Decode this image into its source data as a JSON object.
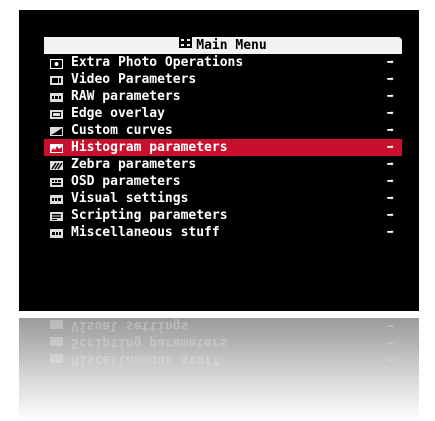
{
  "menu": {
    "title": "Main Menu",
    "title_icon": "menu-grid-icon",
    "selected_index": 5,
    "selected_color": "#c8102e",
    "items": [
      {
        "label": "Extra Photo Operations",
        "icon": "camera-icon",
        "arrow": "➡"
      },
      {
        "label": "Video Parameters",
        "icon": "video-icon",
        "arrow": "➡"
      },
      {
        "label": "RAW parameters",
        "icon": "raw-icon",
        "arrow": "➡"
      },
      {
        "label": "Edge overlay",
        "icon": "edge-overlay-icon",
        "arrow": "➡"
      },
      {
        "label": "Custom curves",
        "icon": "curves-icon",
        "arrow": "➡"
      },
      {
        "label": "Histogram parameters",
        "icon": "histogram-icon",
        "arrow": "➡"
      },
      {
        "label": "Zebra parameters",
        "icon": "zebra-icon",
        "arrow": "➡"
      },
      {
        "label": "OSD parameters",
        "icon": "osd-icon",
        "arrow": "➡"
      },
      {
        "label": "Visual settings",
        "icon": "display-icon",
        "arrow": "➡"
      },
      {
        "label": "Scripting parameters",
        "icon": "script-icon",
        "arrow": "➡"
      },
      {
        "label": "Miscellaneous stuff",
        "icon": "misc-icon",
        "arrow": "➡"
      }
    ]
  }
}
